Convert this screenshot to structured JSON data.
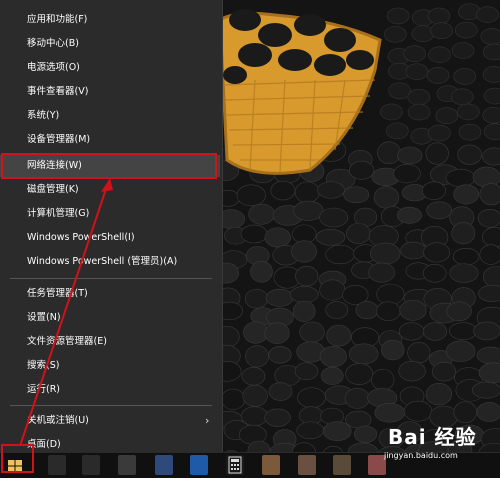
{
  "context_menu": {
    "items": [
      {
        "label": "应用和功能(F)"
      },
      {
        "label": "移动中心(B)"
      },
      {
        "label": "电源选项(O)"
      },
      {
        "label": "事件查看器(V)"
      },
      {
        "label": "系统(Y)"
      },
      {
        "label": "设备管理器(M)"
      },
      {
        "label": "网络连接(W)"
      },
      {
        "label": "磁盘管理(K)"
      },
      {
        "label": "计算机管理(G)"
      },
      {
        "label": "Windows PowerShell(I)"
      },
      {
        "label": "Windows PowerShell (管理员)(A)"
      },
      {
        "label": "任务管理器(T)"
      },
      {
        "label": "设置(N)"
      },
      {
        "label": "文件资源管理器(E)"
      },
      {
        "label": "搜索(S)"
      },
      {
        "label": "运行(R)"
      },
      {
        "label": "关机或注销(U)"
      },
      {
        "label": "桌面(D)"
      }
    ],
    "highlighted_item": "网络连接(W)",
    "submenu_arrow": "›"
  },
  "watermark": {
    "logo": "Bai 经验",
    "url": "jingyan.baidu.com"
  },
  "colors": {
    "menu_bg": "#2b2b2b",
    "highlight_border": "#d0121b",
    "annotation_arrow": "#d0121b"
  },
  "icons": [
    "windows-start-icon",
    "task-view-icon",
    "store-icon",
    "calculator-icon"
  ]
}
